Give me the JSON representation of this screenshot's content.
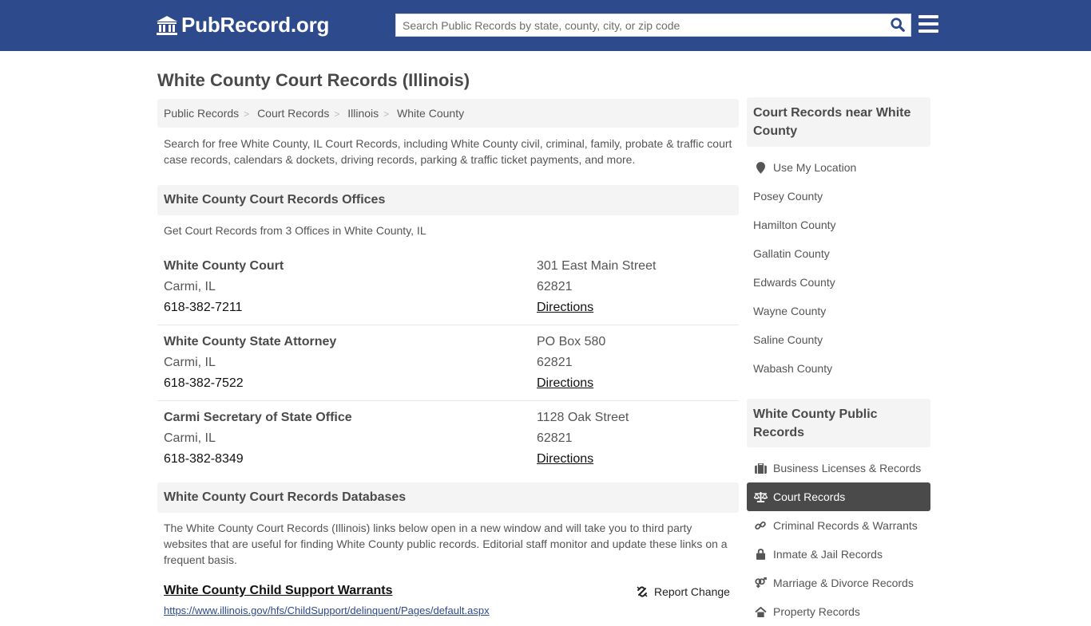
{
  "header": {
    "logo_text": "PubRecord.org",
    "search_placeholder": "Search Public Records by state, county, city, or zip code",
    "brand_color": "#2d4a8c"
  },
  "page": {
    "title": "White County Court Records (Illinois)",
    "breadcrumb": [
      "Public Records",
      "Court Records",
      "Illinois",
      "White County"
    ],
    "intro": "Search for free White County, IL Court Records, including White County civil, criminal, family, probate & traffic court case records, calendars & dockets, driving records, parking & traffic ticket payments, and more."
  },
  "offices_section": {
    "heading": "White County Court Records Offices",
    "subtitle": "Get Court Records from 3 Offices in White County, IL",
    "offices": [
      {
        "name": "White County Court",
        "city": "Carmi, IL",
        "phone": "618-382-7211",
        "address": "301 East Main Street",
        "zip": "62821",
        "directions": "Directions"
      },
      {
        "name": "White County State Attorney",
        "city": "Carmi, IL",
        "phone": "618-382-7522",
        "address": "PO Box 580",
        "zip": "62821",
        "directions": "Directions"
      },
      {
        "name": "Carmi Secretary of State Office",
        "city": "Carmi, IL",
        "phone": "618-382-8349",
        "address": "1128 Oak Street",
        "zip": "62821",
        "directions": "Directions"
      }
    ]
  },
  "databases_section": {
    "heading": "White County Court Records Databases",
    "intro": "The White County Court Records (Illinois) links below open in a new window and will take you to third party websites that are useful for finding White County public records. Editorial staff monitor and update these links on a frequent basis.",
    "links": [
      {
        "title": "White County Child Support Warrants",
        "url": "https://www.illinois.gov/hfs/ChildSupport/delinquent/Pages/default.aspx",
        "report_label": "Report Change"
      }
    ]
  },
  "sidebar": {
    "nearby": {
      "heading": "Court Records near White County",
      "use_location": "Use My Location",
      "counties": [
        "Posey County",
        "Hamilton County",
        "Gallatin County",
        "Edwards County",
        "Wayne County",
        "Saline County",
        "Wabash County"
      ]
    },
    "public_records": {
      "heading": "White County Public Records",
      "items": [
        {
          "label": "Business Licenses & Records",
          "icon": "briefcase-icon",
          "active": false
        },
        {
          "label": "Court Records",
          "icon": "balance-scale-icon",
          "active": true
        },
        {
          "label": "Criminal Records & Warrants",
          "icon": "link-icon",
          "active": false
        },
        {
          "label": "Inmate & Jail Records",
          "icon": "lock-icon",
          "active": false
        },
        {
          "label": "Marriage & Divorce Records",
          "icon": "venus-mars-icon",
          "active": false
        },
        {
          "label": "Property Records",
          "icon": "home-icon",
          "active": false
        }
      ]
    }
  }
}
